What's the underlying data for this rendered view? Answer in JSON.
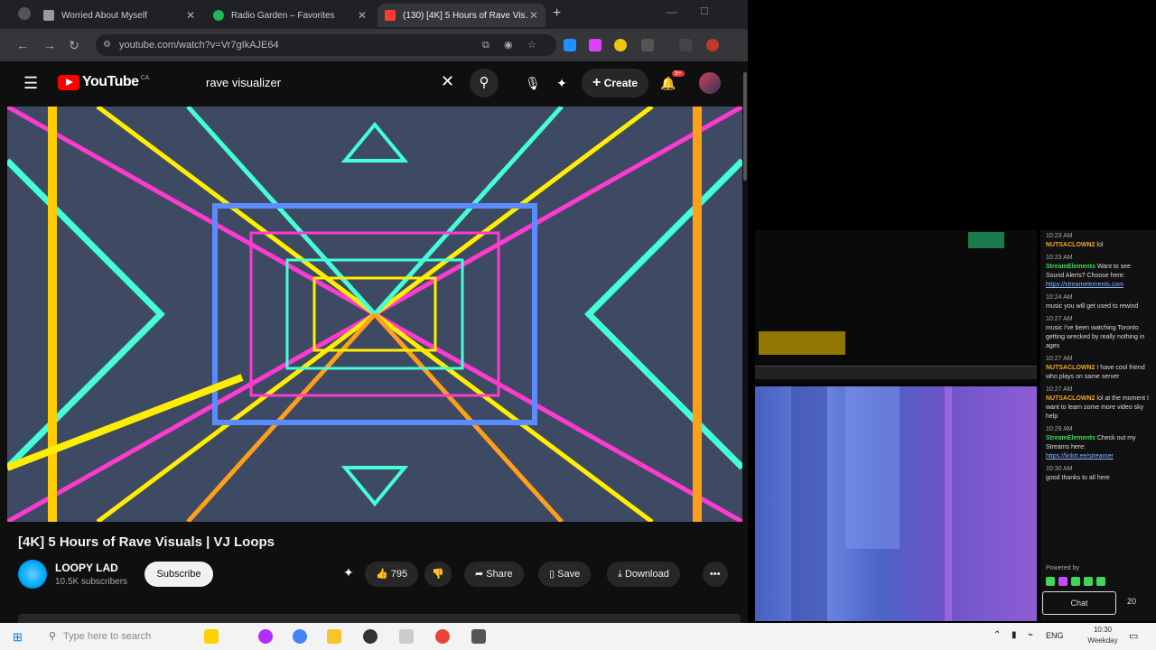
{
  "browser": {
    "tabs": [
      {
        "title": "Worried About Myself",
        "color": "#999999"
      },
      {
        "title": "Radio Garden – Favorites",
        "color": "#1db954"
      },
      {
        "title": "(130) [4K] 5 Hours of Rave Vis…",
        "color": "#ff3b30"
      }
    ],
    "new_tab": "+",
    "url": "youtube.com/watch?v=Vr7gIkAJE64"
  },
  "youtube": {
    "logo_text": "YouTube",
    "logo_country": "CA",
    "search_value": "rave visualizer",
    "create_label": "Create",
    "notif_count": "9+",
    "video": {
      "title": "[4K] 5 Hours of Rave Visuals | VJ Loops",
      "channel": "LOOPY LAD",
      "subscribers": "10.5K subscribers",
      "subscribe_label": "Subscribe",
      "likes": "795",
      "share_label": "Share",
      "save_label": "Save",
      "download_label": "Download"
    }
  },
  "chat": {
    "messages": [
      {
        "time": "10:23 AM",
        "user": "NUTSACLOWN2",
        "text": "lol",
        "type": "orange"
      },
      {
        "time": "10:23 AM",
        "user": "StreamElements",
        "text": "Want to see Sound Alerts? Choose here:",
        "link": "https://streamelements.com",
        "type": "green"
      },
      {
        "time": "10:24 AM",
        "user": "",
        "text": "music you will get used to rewind",
        "type": "plain"
      },
      {
        "time": "10:27 AM",
        "user": "",
        "text": "music i've been watching Toronto getting wrecked by really nothing in ages",
        "type": "plain"
      },
      {
        "time": "10:27 AM",
        "user": "NUTSACLOWN2",
        "text": "I have cool friend who plays on same server",
        "type": "orange"
      },
      {
        "time": "10:27 AM",
        "user": "NUTSACLOWN2",
        "text": "lol at the moment I want to learn some more video sky help",
        "type": "orange"
      },
      {
        "time": "10:29 AM",
        "user": "StreamElements",
        "text": "Check out my Streams here:",
        "link": "https://linktr.ee/streamer",
        "type": "green"
      },
      {
        "time": "10:30 AM",
        "user": "",
        "text": "good thanks to all here",
        "type": "plain"
      }
    ],
    "footer_label": "Powered by",
    "chat_button": "Chat",
    "viewer_count": "20"
  },
  "taskbar": {
    "search_placeholder": "Type here to search",
    "lang": "ENG",
    "time": "10:30",
    "date": "Weekday"
  }
}
